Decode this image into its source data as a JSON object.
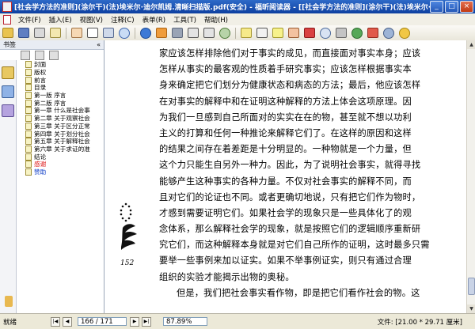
{
  "window": {
    "title": "[社会学方法的准则](涂尔干)(法)埃米尔·迪尔凯姆.清晰扫描版.pdf(安全) - 福昕阅读器 - [[社会学方法的准则](涂尔干)(法)埃米尔·迪尔凯姆.清晰",
    "min_label": "_",
    "max_label": "□",
    "close_label": "×"
  },
  "menu": [
    "文件(F)",
    "插入(E)",
    "视图(V)",
    "注释(C)",
    "表单(R)",
    "工具(T)",
    "帮助(H)"
  ],
  "sidebar": {
    "header": "书签",
    "collapse_label": "«",
    "items": [
      {
        "label": "封面",
        "color": "normal"
      },
      {
        "label": "版权",
        "color": "normal"
      },
      {
        "label": "前言",
        "color": "normal"
      },
      {
        "label": "目录",
        "color": "normal"
      },
      {
        "label": "第一版  序言",
        "color": "normal"
      },
      {
        "label": "第二版  序言",
        "color": "normal"
      },
      {
        "label": "第一章  什么是社会事",
        "color": "normal"
      },
      {
        "label": "第二章  关于观察社会",
        "color": "normal"
      },
      {
        "label": "第三章  关于区分正常",
        "color": "normal"
      },
      {
        "label": "第四章  关于划分社会",
        "color": "normal"
      },
      {
        "label": "第五章  关于解释社会",
        "color": "normal"
      },
      {
        "label": "第六章  关于求证的准",
        "color": "normal"
      },
      {
        "label": "结论",
        "color": "normal"
      },
      {
        "label": "感谢",
        "color": "red"
      },
      {
        "label": "赞助",
        "color": "blue"
      }
    ]
  },
  "document": {
    "lines": [
      "家应该怎样排除他们对于事实的成见，而直接面对事实本身；应该",
      "怎样从事实的最客观的性质着手研究事实；应该怎样根据事实本",
      "身来确定把它们划分为健康状态和病态的方法；最后，他应该怎样",
      "在对事实的解释中和在证明这种解释的方法上体会这项原理。因",
      "为我们一旦感到自己所面对的实实在在的物，甚至就不想以功利",
      "主义的打算和任何一种推论来解释它们了。在这样的原因和这样",
      "的结果之间存在着差距是十分明显的。一种物就是一个力量，但",
      "这个力只能生自另外一种力。因此，为了说明社会事实，就得寻找",
      "能够产生这种事实的各种力量。不仅对社会事实的解释不同，而",
      "且对它们的论证也不同。或者更确切地说，只有把它们作为物时，",
      "才感到需要证明它们。如果社会学的现象只是一些具体化了的观",
      "念体系，那么解释社会学的现象，就是按照它们的逻辑顺序重新研",
      "究它们，而这种解释本身就是对它们自己所作的证明，这时最多只需",
      "要举一些事例来加以证实。如果不举事例证实，则只有通过合理",
      "组织的实验才能揭示出物的奥秘。",
      "但是，我们把社会事实看作物，即是把它们看作社会的物。这"
    ],
    "page_number": "152"
  },
  "status": {
    "ready": "就绪",
    "first": "|◀",
    "prev": "◀",
    "page": "166 / 171",
    "next": "▶",
    "last": "▶|",
    "zoom": "87.89%",
    "size": "文件: [21.00 * 29.71 厘米]"
  },
  "colors": {
    "titlebar": "#1a4fb4",
    "bookmark_red": "#dd1111",
    "bookmark_blue": "#1340c8"
  }
}
